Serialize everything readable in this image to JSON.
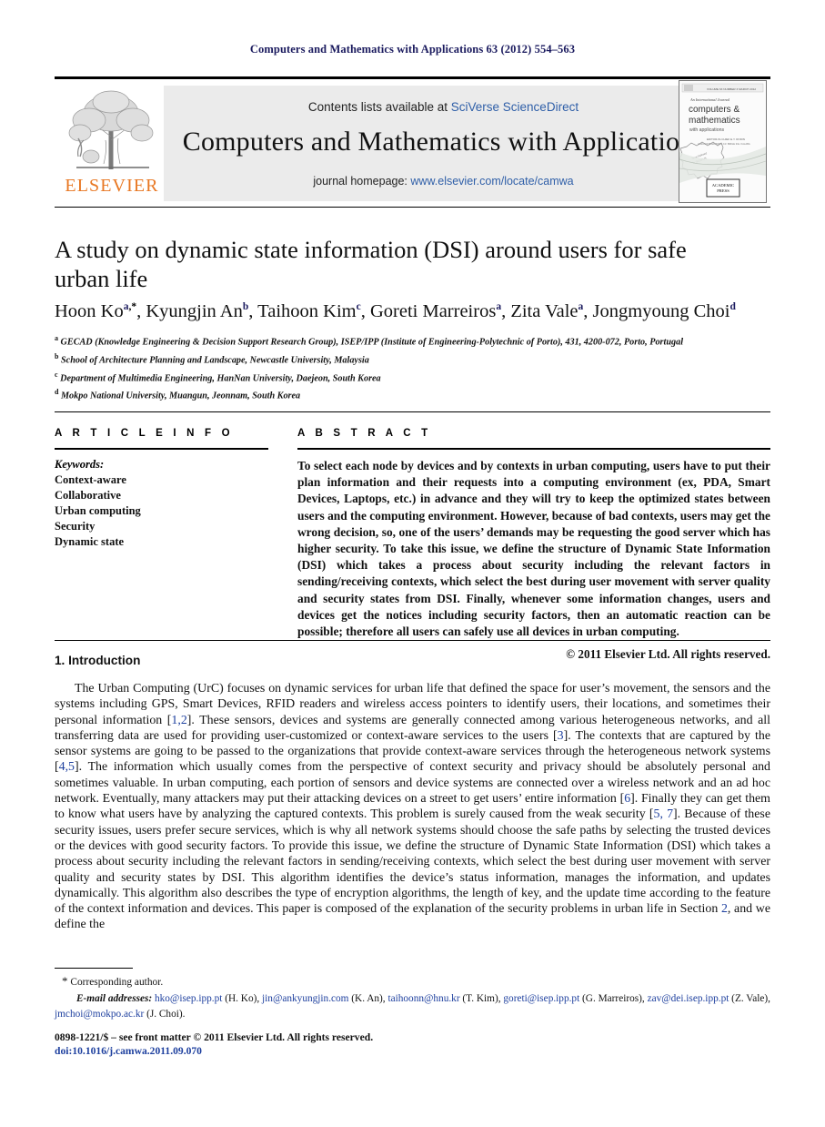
{
  "running_head": "Computers and Mathematics with Applications 63 (2012) 554–563",
  "masthead": {
    "contents_prefix": "Contents lists available at ",
    "contents_link": "SciVerse ScienceDirect",
    "journal_title": "Computers and Mathematics with Applications",
    "homepage_prefix": "journal homepage: ",
    "homepage_link": "www.elsevier.com/locate/camwa",
    "publisher_name": "ELSEVIER",
    "publisher_color": "#E87722",
    "link_color": "#2f5fa8",
    "cover": {
      "eyebrow": "An International Journal",
      "line1": "computers &",
      "line2": "mathematics",
      "line3": "with applications",
      "seal": "ACADEMIC PRESS"
    }
  },
  "article": {
    "title": "A study on dynamic state information (DSI) around users for safe urban life",
    "authors": [
      {
        "name": "Hoon Ko",
        "sup": "a",
        "star": true
      },
      {
        "name": "Kyungjin An",
        "sup": "b",
        "star": false
      },
      {
        "name": "Taihoon Kim",
        "sup": "c",
        "star": false
      },
      {
        "name": "Goreti Marreiros",
        "sup": "a",
        "star": false
      },
      {
        "name": "Zita Vale",
        "sup": "a",
        "star": false
      },
      {
        "name": "Jongmyoung Choi",
        "sup": "d",
        "star": false
      }
    ],
    "affiliations": [
      {
        "marker": "a",
        "text": "GECAD (Knowledge Engineering & Decision Support Research Group), ISEP/IPP (Institute of Engineering-Polytechnic of Porto), 431, 4200-072, Porto, Portugal"
      },
      {
        "marker": "b",
        "text": "School of Architecture Planning and Landscape, Newcastle University, Malaysia"
      },
      {
        "marker": "c",
        "text": "Department of Multimedia Engineering, HanNan University, Daejeon, South Korea"
      },
      {
        "marker": "d",
        "text": "Mokpo National University, Muangun, Jeonnam, South Korea"
      }
    ]
  },
  "article_info": {
    "heading": "A R T I C L E    I N F O",
    "keywords_label": "Keywords:",
    "keywords": [
      "Context-aware",
      "Collaborative",
      "Urban computing",
      "Security",
      "Dynamic state"
    ]
  },
  "abstract": {
    "heading": "A B S T R A C T",
    "text": "To select each node by devices and by contexts in urban computing, users have to put their plan information and their requests into a computing environment (ex, PDA, Smart Devices, Laptops, etc.) in advance and they will try to keep the optimized states between users and the computing environment. However, because of bad contexts, users may get the wrong decision, so, one of the users’ demands may be requesting the good server which has higher security. To take this issue, we define the structure of Dynamic State Information (DSI) which takes a process about security including the relevant factors in sending/receiving contexts, which select the best during user movement with server quality and security states from DSI. Finally, whenever some information changes, users and devices get the notices including security factors, then an automatic reaction can be possible; therefore all users can safely use all devices in urban computing.",
    "copyright": "© 2011 Elsevier Ltd. All rights reserved."
  },
  "introduction": {
    "heading": "1. Introduction",
    "paragraph_parts": [
      {
        "t": "The Urban Computing (UrC) focuses on dynamic services for urban life that defined the space for user’s movement, the sensors and the systems including GPS, Smart Devices, RFID readers and wireless access pointers to identify users, their locations, and sometimes their personal information ["
      },
      {
        "r": "1,2"
      },
      {
        "t": "]. These sensors, devices and systems are generally connected among various heterogeneous networks, and all transferring data are used for providing user-customized or context-aware services to the users ["
      },
      {
        "r": "3"
      },
      {
        "t": "]. The contexts that are captured by the sensor systems are going to be passed to the organizations that provide context-aware services through the heterogeneous network systems ["
      },
      {
        "r": "4,5"
      },
      {
        "t": "]. The information which usually comes from the perspective of context security and privacy should be absolutely personal and sometimes valuable. In urban computing, each portion of sensors and device systems are connected over a wireless network and an ad hoc network. Eventually, many attackers may put their attacking devices on a street to get users’ entire information ["
      },
      {
        "r": "6"
      },
      {
        "t": "]. Finally they can get them to know what users have by analyzing the captured contexts. This problem is surely caused from the weak security ["
      },
      {
        "r": "5, 7"
      },
      {
        "t": "]. Because of these security issues, users prefer secure services, which is why all network systems should choose the safe paths by selecting the trusted devices or the devices with good security factors. To provide this issue, we define the structure of Dynamic State Information (DSI) which takes a process about security including the relevant factors in sending/receiving contexts, which select the best during user movement with server quality and security states by DSI. This algorithm identifies the device’s status information, manages the information, and updates dynamically. This algorithm also describes the type of encryption algorithms, the length of key, and the update time according to the feature of the context information and devices. This paper is composed of the explanation of the security problems in urban life in Section "
      },
      {
        "r": "2"
      },
      {
        "t": ", and we define the"
      }
    ]
  },
  "footnotes": {
    "corresponding": "Corresponding author.",
    "email_label": "E-mail addresses:",
    "emails": [
      {
        "addr": "hko@isep.ipp.pt",
        "who": " (H. Ko), "
      },
      {
        "addr": "jin@ankyungjin.com",
        "who": " (K. An), "
      },
      {
        "addr": "taihoonn@hnu.kr",
        "who": " (T. Kim), "
      },
      {
        "addr": "goreti@isep.ipp.pt",
        "who": " (G. Marreiros), "
      },
      {
        "addr": "zav@dei.isep.ipp.pt",
        "who": " (Z. Vale), "
      },
      {
        "addr": "jmchoi@mokpo.ac.kr",
        "who": " (J. Choi)."
      }
    ],
    "issn_line": "0898-1221/$ – see front matter © 2011 Elsevier Ltd. All rights reserved.",
    "doi_line": "doi:10.1016/j.camwa.2011.09.070"
  }
}
